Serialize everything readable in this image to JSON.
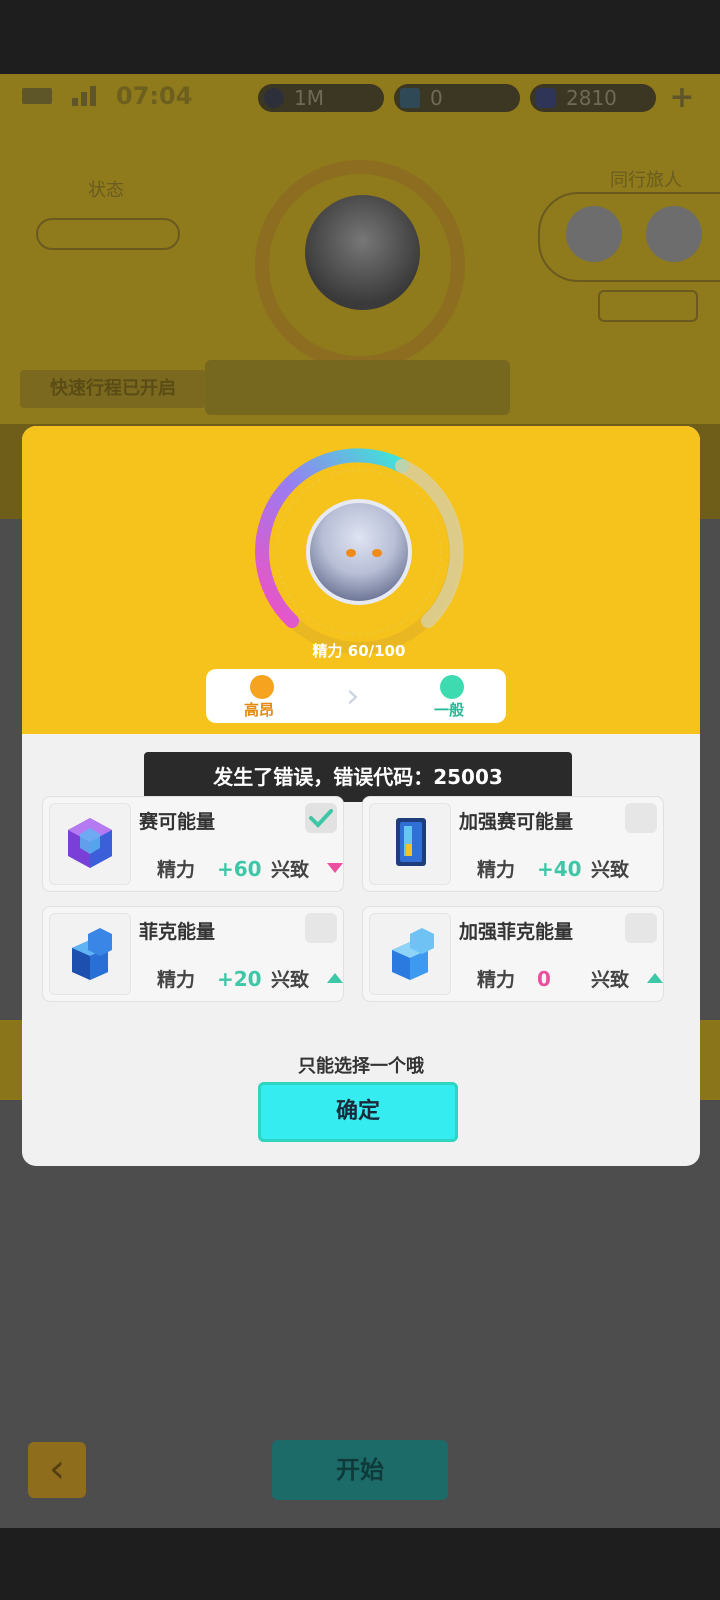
{
  "status_bar": {
    "time": "07:04",
    "coins": "1M",
    "tickets": "0",
    "gems": "2810"
  },
  "background": {
    "state_label": "状态",
    "companions_label": "同行旅人",
    "quick_trip": "快速行程已开启"
  },
  "modal": {
    "energy_label": "精力 60/100",
    "mood_from": "高昂",
    "mood_to": "一般",
    "error_message": "发生了错误，错误代码：25003",
    "items": [
      {
        "name": "赛可能量",
        "stat1": "精力",
        "value": "+60",
        "stat2": "兴致",
        "trend": "down",
        "checked": true
      },
      {
        "name": "加强赛可能量",
        "stat1": "精力",
        "value": "+40",
        "stat2": "兴致",
        "trend": "none",
        "checked": false
      },
      {
        "name": "菲克能量",
        "stat1": "精力",
        "value": "+20",
        "stat2": "兴致",
        "trend": "up",
        "checked": false
      },
      {
        "name": "加强菲克能量",
        "stat1": "精力",
        "value": "0",
        "stat2": "兴致",
        "trend": "up",
        "checked": false
      }
    ],
    "hint": "只能选择一个哦",
    "confirm_label": "确定"
  },
  "bottom": {
    "start_label": "开始"
  },
  "colors": {
    "accent_yellow": "#f6c21c",
    "positive": "#3ec7a6",
    "negative": "#ec4f9d",
    "confirm": "#35edf0"
  }
}
